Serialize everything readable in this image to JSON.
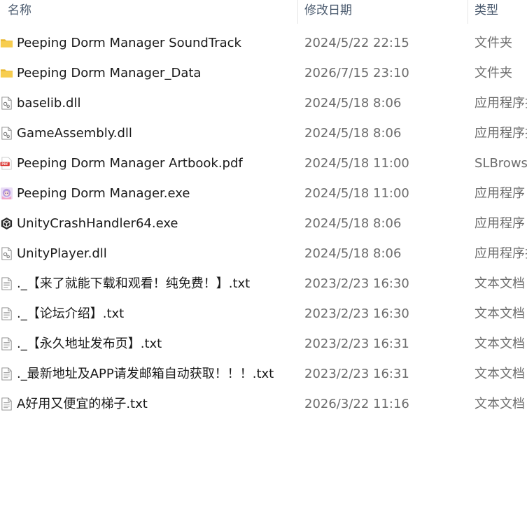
{
  "columns": {
    "name": "名称",
    "date": "修改日期",
    "type": "类型"
  },
  "files": [
    {
      "name": "Peeping Dorm Manager SoundTrack",
      "date": "2024/5/22 22:15",
      "type": "文件夹",
      "icon": "folder-icon"
    },
    {
      "name": "Peeping Dorm Manager_Data",
      "date": "2026/7/15 23:10",
      "type": "文件夹",
      "icon": "folder-icon"
    },
    {
      "name": "baselib.dll",
      "date": "2024/5/18 8:06",
      "type": "应用程序扩展",
      "icon": "dll-file-icon"
    },
    {
      "name": "GameAssembly.dll",
      "date": "2024/5/18 8:06",
      "type": "应用程序扩展",
      "icon": "dll-file-icon"
    },
    {
      "name": "Peeping Dorm Manager Artbook.pdf",
      "date": "2024/5/18 11:00",
      "type": "SLBrowser",
      "icon": "pdf-file-icon"
    },
    {
      "name": "Peeping Dorm Manager.exe",
      "date": "2024/5/18 11:00",
      "type": "应用程序",
      "icon": "game-exe-icon"
    },
    {
      "name": "UnityCrashHandler64.exe",
      "date": "2024/5/18 8:06",
      "type": "应用程序",
      "icon": "unity-exe-icon"
    },
    {
      "name": "UnityPlayer.dll",
      "date": "2024/5/18 8:06",
      "type": "应用程序扩展",
      "icon": "dll-file-icon"
    },
    {
      "name": "._【来了就能下载和观看！纯免费！】.txt",
      "date": "2023/2/23 16:30",
      "type": "文本文档",
      "icon": "text-file-icon"
    },
    {
      "name": "._【论坛介绍】.txt",
      "date": "2023/2/23 16:30",
      "type": "文本文档",
      "icon": "text-file-icon"
    },
    {
      "name": "._【永久地址发布页】.txt",
      "date": "2023/2/23 16:31",
      "type": "文本文档",
      "icon": "text-file-icon"
    },
    {
      "name": "._最新地址及APP请发邮箱自动获取！！！.txt",
      "date": "2023/2/23 16:31",
      "type": "文本文档",
      "icon": "text-file-icon"
    },
    {
      "name": "A好用又便宜的梯子.txt",
      "date": "2026/3/22 11:16",
      "type": "文本文档",
      "icon": "text-file-icon"
    }
  ],
  "colors": {
    "folder": "#f4c542",
    "header_text": "#4a5a6e",
    "secondary_text": "#6d6d6d",
    "pdf_red": "#d9322e"
  }
}
